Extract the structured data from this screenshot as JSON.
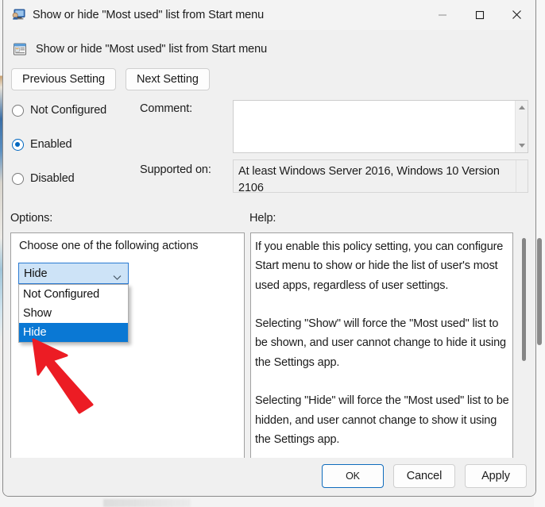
{
  "window": {
    "title": "Show or hide \"Most used\" list from Start menu",
    "icon": "policy-setting-window-icon",
    "controls": {
      "minimize": "minimize-icon",
      "maximize": "maximize-icon",
      "close": "close-icon"
    }
  },
  "header": {
    "icon": "policy-document-icon",
    "title": "Show or hide \"Most used\" list from Start menu"
  },
  "nav": {
    "previous_label": "Previous Setting",
    "next_label": "Next Setting"
  },
  "state": {
    "options": [
      {
        "label": "Not Configured",
        "checked": false
      },
      {
        "label": "Enabled",
        "checked": true
      },
      {
        "label": "Disabled",
        "checked": false
      }
    ]
  },
  "comment": {
    "label": "Comment:",
    "value": "",
    "placeholder": ""
  },
  "supported": {
    "label": "Supported on:",
    "value": "At least Windows Server 2016, Windows 10 Version 2106"
  },
  "sections": {
    "options_label": "Options:",
    "help_label": "Help:"
  },
  "options_panel": {
    "prompt": "Choose one of the following actions",
    "combo": {
      "selected": "Hide",
      "expanded": true,
      "options": [
        {
          "label": "Not Configured",
          "selected": false
        },
        {
          "label": "Show",
          "selected": false
        },
        {
          "label": "Hide",
          "selected": true
        }
      ]
    }
  },
  "help_panel": {
    "paragraphs": [
      "If you enable this policy setting, you can configure Start menu to show or hide the list of user's most used apps, regardless of user settings.",
      "Selecting \"Show\" will force the \"Most used\" list to be shown, and user cannot change to hide it using the Settings app.",
      "Selecting \"Hide\" will force the \"Most used\" list to be hidden, and user cannot change to show it using the Settings app."
    ]
  },
  "footer": {
    "ok_label": "OK",
    "cancel_label": "Cancel",
    "apply_label": "Apply"
  },
  "annotation": {
    "arrow": "red-pointer-arrow",
    "color": "#ec1c24"
  },
  "colors": {
    "accent": "#0067c0",
    "selection": "#0a78d4",
    "combo_fill": "#cde3f7",
    "combo_border": "#2a7ad2",
    "dialog_bg": "#f0f0f0",
    "titlebar_bg": "#f3f3f3"
  }
}
